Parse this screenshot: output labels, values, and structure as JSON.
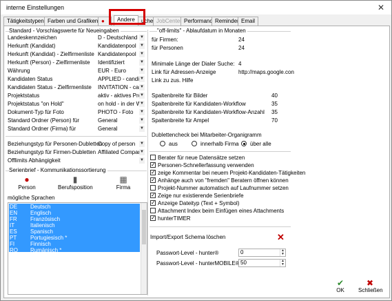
{
  "window": {
    "title": "interne Einstellungen",
    "close": "✕"
  },
  "tabs": [
    "Tätigkeitstypen",
    "Farben und Grafiken",
    "",
    "Andere",
    "uche",
    "JobCenter",
    "Performance",
    "Reminder",
    "Email"
  ],
  "left": {
    "section_title": "Standard - Vorschlagswerte für Neueingaben",
    "rows": [
      {
        "label": "Landeskennzeichen",
        "value": "D - Deutschland"
      },
      {
        "label": "Herkunft (Kandidat)",
        "value": "Kandidatenpool"
      },
      {
        "label": "Herkunft (Kandidat) - Zielfirmenliste",
        "value": "Kandidatenpool"
      },
      {
        "label": "Herkunft (Person) - Zielfirmenliste",
        "value": "Identifiziert"
      },
      {
        "label": "Währung",
        "value": "EUR - Euro"
      },
      {
        "label": "Kandidaten Status",
        "value": "APPLIED - candida"
      },
      {
        "label": "Kandidaten Status - Zielfirmenliste",
        "value": "INVITATION - canc"
      },
      {
        "label": "Projektstatus",
        "value": "aktiv - aktives Proje"
      },
      {
        "label": "Projektstatus \"on Hold\"",
        "value": "on hold - in der Wa"
      },
      {
        "label": "Dokument-Typ für Foto",
        "value": "PHOTO - Foto"
      },
      {
        "label": "Standard Ordner (Person) für",
        "value": "General"
      },
      {
        "label": "Standard Ordner (Firma) für",
        "value": "General"
      }
    ],
    "rows2": [
      {
        "label": "Beziehungstyp für Personen-Dubletten",
        "value": "Copy of person"
      },
      {
        "label": "Beziehungstyp für Firmen-Dubletten",
        "value": "Affiliated Company"
      },
      {
        "label": "Offlimits Abhängigkeit",
        "value": ""
      }
    ],
    "serial_title": "Serienbrief - Kommunikationssortierung",
    "serial_icons": [
      {
        "label": "Person",
        "icon": "person-icon"
      },
      {
        "label": "Berufsposition",
        "icon": "briefcase-icon"
      },
      {
        "label": "Firma",
        "icon": "building-icon"
      }
    ],
    "languages_title": "mögliche Sprachen",
    "languages": [
      {
        "code": "DE",
        "name": "Deutsch"
      },
      {
        "code": "EN",
        "name": "Englisch"
      },
      {
        "code": "FR",
        "name": "Französisch"
      },
      {
        "code": "IT",
        "name": "Italienisch"
      },
      {
        "code": "ES",
        "name": "Spanisch"
      },
      {
        "code": "PT",
        "name": "Portugiesisch *"
      },
      {
        "code": "FI",
        "name": "Finnisch"
      },
      {
        "code": "RO",
        "name": "Rumänisch *"
      }
    ]
  },
  "right": {
    "offlimits_title": "\"off-limits\" - Ablaufdatum in Monaten",
    "offlimits": [
      {
        "label": "für Firmen:",
        "value": "24"
      },
      {
        "label": "für Personen",
        "value": "24"
      }
    ],
    "misc": [
      {
        "label": "Minimale Länge der Dialer Suche:",
        "value": "4"
      },
      {
        "label": "Link für Adressen-Anzeige",
        "value": "http://maps.google.con"
      },
      {
        "label": "Link zu zus. Hilfe",
        "value": ""
      }
    ],
    "widths": [
      {
        "label": "Spaltenbreite für Bilder",
        "value": "40"
      },
      {
        "label": "Spaltenbreite für Kandidaten-Workflow",
        "value": "35"
      },
      {
        "label": "Spaltenbreite für Kandidaten-Workflow-Anzahl",
        "value": "35"
      },
      {
        "label": "Spaltenbreite für Ampel",
        "value": "70"
      }
    ],
    "dub_title": "Dublettencheck bei Mitarbeiter-Organigramm",
    "dub_options": [
      "aus",
      "innerhalb Firma",
      "über alle"
    ],
    "checkboxes": [
      {
        "label": "Berater für neue Datensätze setzen",
        "checked": false
      },
      {
        "label": "Personen-Schnellerfassung verwenden",
        "checked": true
      },
      {
        "label": "zeige Kommentar bei neuem Projekt-Kandidaten-Tätigkeiten",
        "checked": true
      },
      {
        "label": "Anhänge auch von \"fremden\" Beratern öffnen können",
        "checked": true
      },
      {
        "label": "Projekt-Nummer automatisch auf Laufnummer setzen",
        "checked": false
      },
      {
        "label": "Zeige nur existierende Serienbriefe",
        "checked": true
      },
      {
        "label": "Anzeige Dateityp (Text + Symbol)",
        "checked": true
      },
      {
        "label": "Attachment Index beim Einfügen eines Attachments",
        "checked": false
      },
      {
        "label": "hunterTIMER",
        "checked": true
      }
    ],
    "schema_label": "Import/Export Schema löschen",
    "password": [
      {
        "label": "Passwort-Level - hunter®",
        "value": "0"
      },
      {
        "label": "Passwort-Level - hunterMOBILE®",
        "value": "50"
      }
    ]
  },
  "buttons": {
    "ok": "OK",
    "close": "Schließen"
  },
  "colors": {
    "highlight": "#d40000",
    "selection": "#3399ff"
  }
}
